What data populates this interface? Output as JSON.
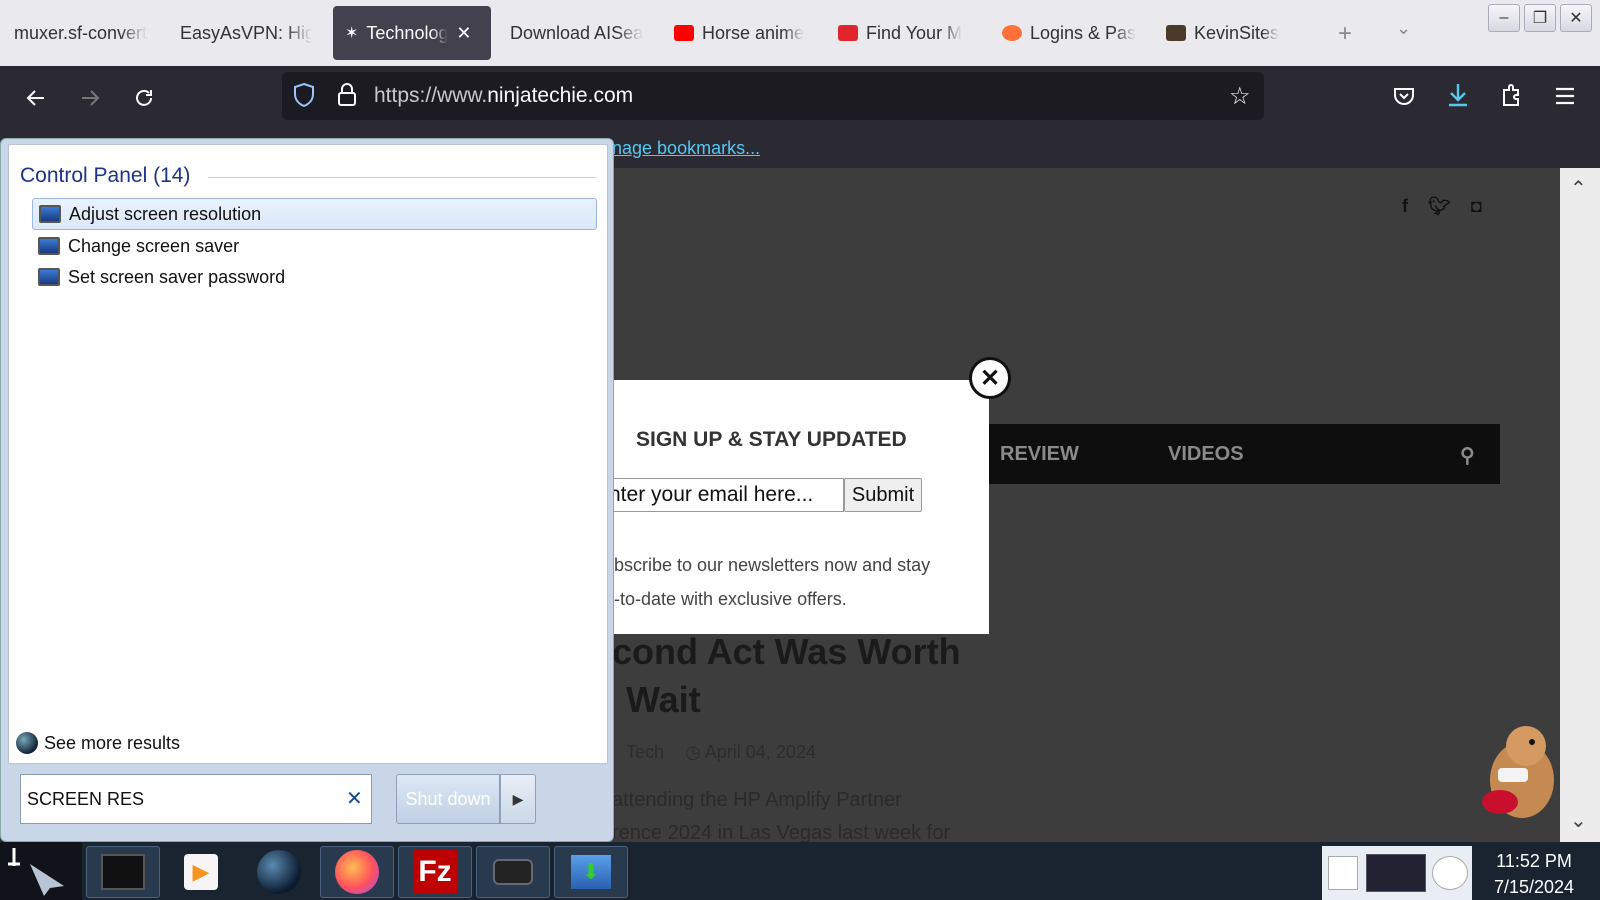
{
  "browser": {
    "tabs": [
      {
        "label": "muxer.sf-convert",
        "icon": "none",
        "color": ""
      },
      {
        "label": "EasyAsVPN: High",
        "icon": "none",
        "color": ""
      },
      {
        "label": "Technology",
        "icon": "ninja-icon",
        "color": "#42414d",
        "active": true
      },
      {
        "label": "Download AISea",
        "icon": "none",
        "color": ""
      },
      {
        "label": "Horse anime",
        "icon": "youtube-icon",
        "color": "#ff0000"
      },
      {
        "label": "Find Your M",
        "icon": "pocket-icon",
        "color": "#e0252c"
      },
      {
        "label": "Logins & Pas",
        "icon": "firefox-icon",
        "color": "#ff7139"
      },
      {
        "label": "KevinSites",
        "icon": "site-icon",
        "color": "#4a3a2a"
      }
    ],
    "url_prefix": "https://www.",
    "url_domain": "ninjatechie.com",
    "bookmarks_link": "nage bookmarks..."
  },
  "page": {
    "menu": [
      "REVIEW",
      "VIDEOS"
    ],
    "headline_line1": "cond Act Was Worth",
    "headline_line2": "Wait",
    "meta_author": "Tech",
    "meta_date": "April 04, 2024",
    "excerpt_line1": "attending the HP Amplify Partner",
    "excerpt_line2": "rence 2024 in Las Vegas last week for"
  },
  "modal": {
    "title": "SIGN UP & STAY UPDATED",
    "email_placeholder": "nter your email here...",
    "submit_label": "Submit",
    "desc_line1": "bscribe to our newsletters now and stay",
    "desc_line2": "-to-date with exclusive offers."
  },
  "start_menu": {
    "group_heading": "Control Panel (14)",
    "results": [
      "Adjust screen resolution",
      "Change screen saver",
      "Set screen saver password"
    ],
    "see_more": "See more results",
    "search_value": "SCREEN RES",
    "shutdown_label": "Shut down"
  },
  "taskbar": {
    "time": "11:52 PM",
    "date": "7/15/2024"
  },
  "colors": {
    "accent": "#55c8f0",
    "taskbar": "#1a2430"
  }
}
